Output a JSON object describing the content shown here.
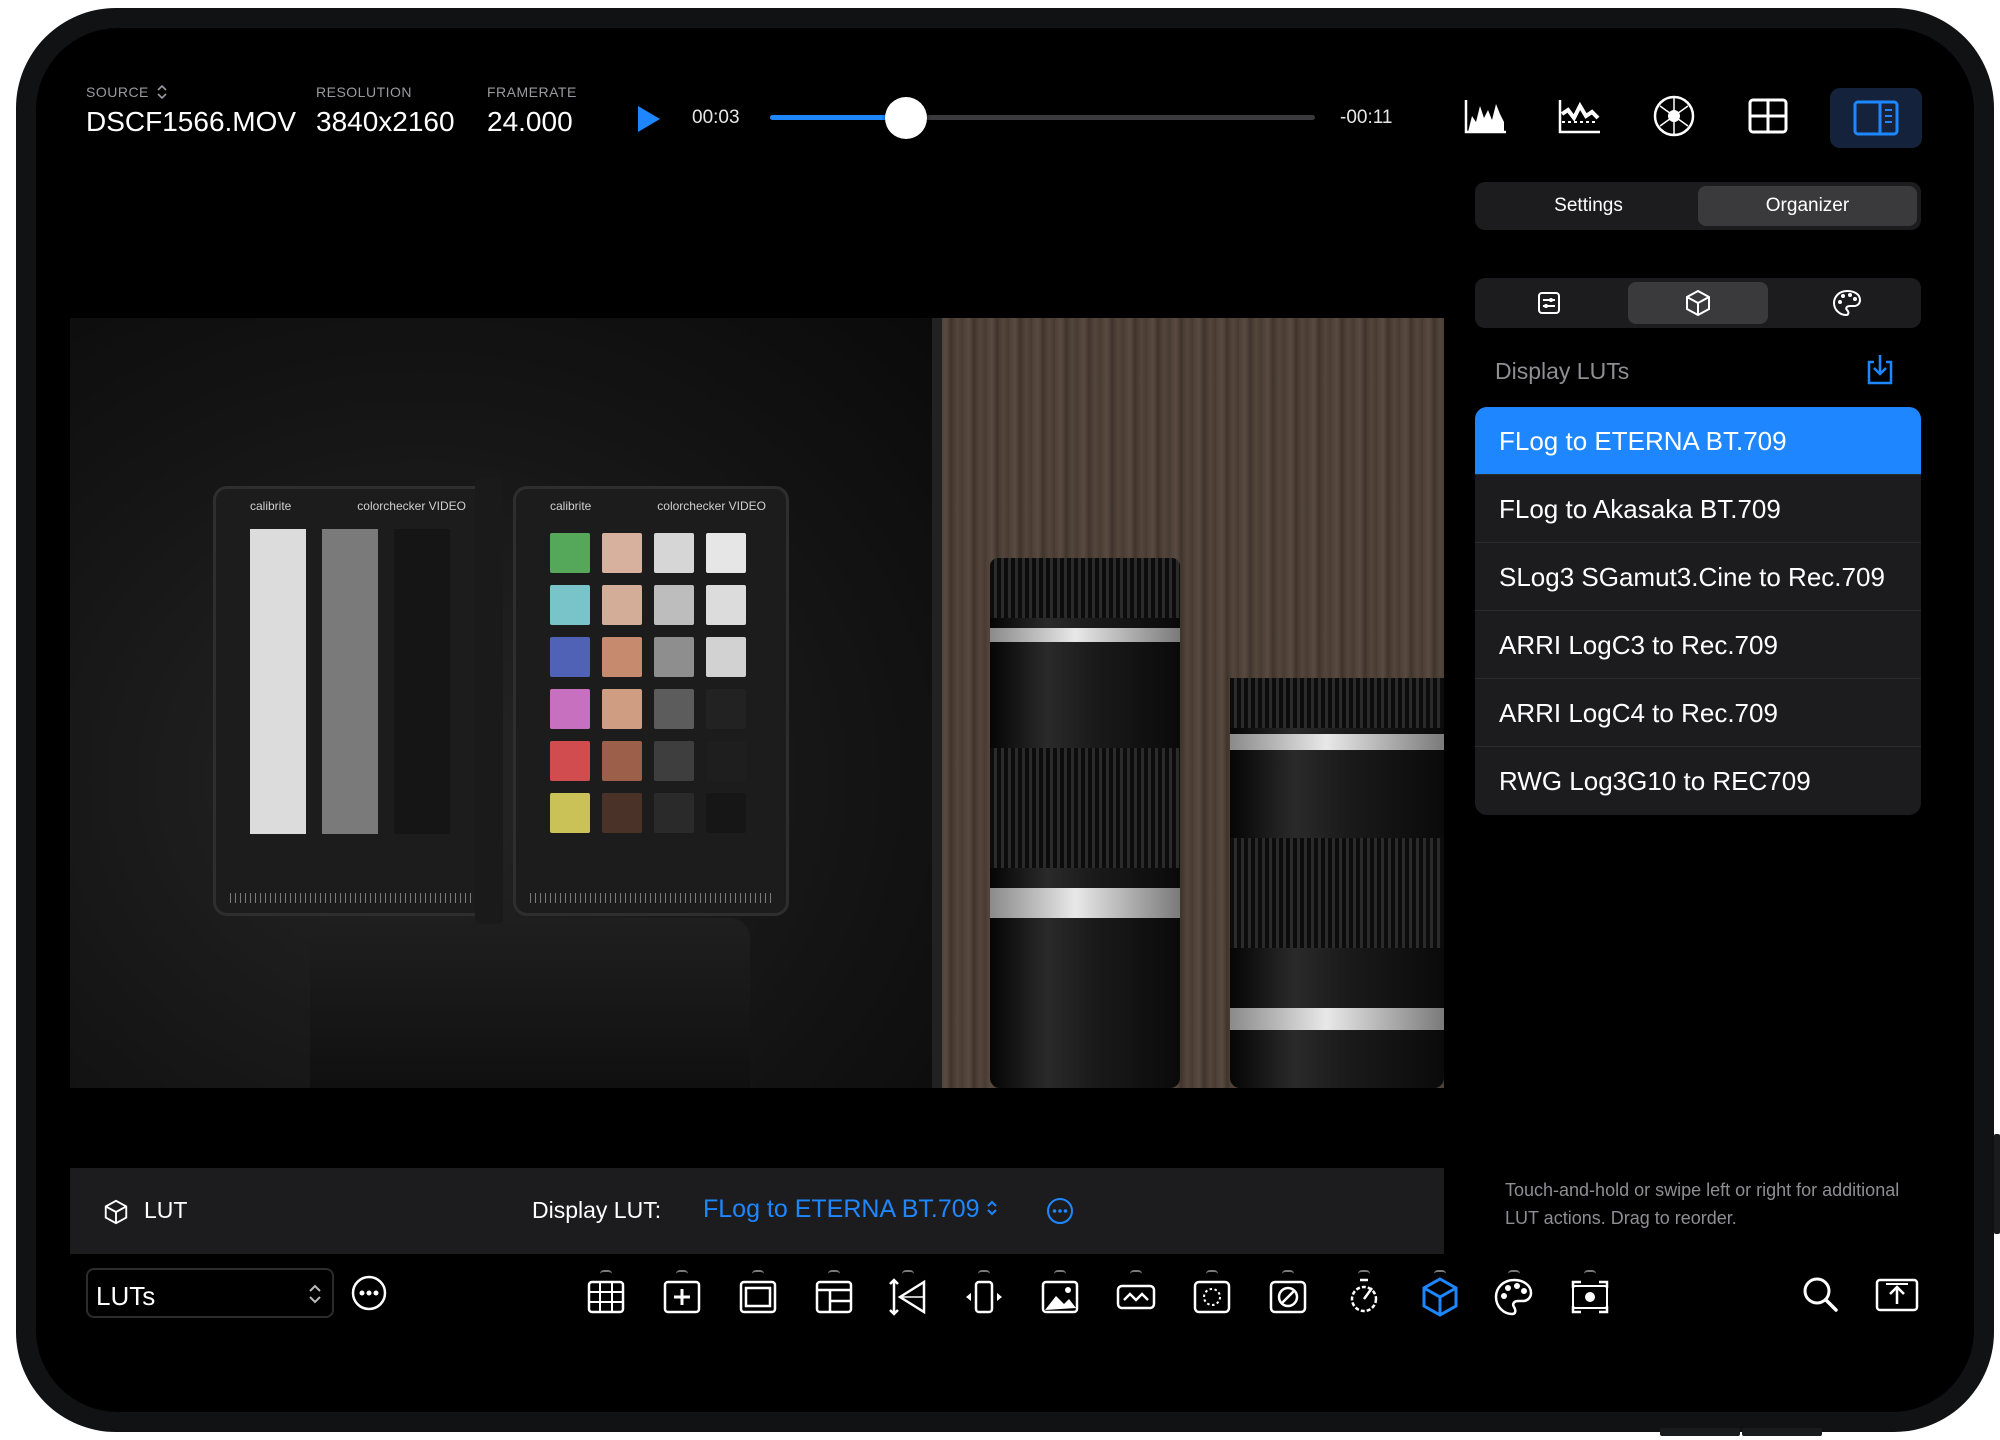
{
  "header": {
    "source": {
      "label": "SOURCE",
      "value": "DSCF1566.MOV"
    },
    "resolution": {
      "label": "RESOLUTION",
      "value": "3840x2160"
    },
    "framerate": {
      "label": "FRAMERATE",
      "value": "24.000"
    }
  },
  "playback": {
    "elapsed": "00:03",
    "remaining": "-00:11",
    "progress": 0.25
  },
  "colors": {
    "accent": "#1e87ff",
    "panel": "#1c1c1e",
    "background": "#000000"
  },
  "top_icons": [
    "histogram-icon",
    "waveform-icon",
    "vectorscope-icon",
    "grid-layout-icon",
    "side-panel-icon"
  ],
  "photo": {
    "left_brand": "calibrite",
    "left_title": "colorchecker VIDEO",
    "right_brand": "calibrite",
    "right_title": "colorchecker VIDEO"
  },
  "sidebar": {
    "tabs": [
      {
        "label": "Settings",
        "active": false
      },
      {
        "label": "Organizer",
        "active": true
      }
    ],
    "subtabs": [
      "sliders-icon",
      "cube-icon",
      "palette-icon"
    ],
    "section_title": "Display LUTs",
    "luts": [
      {
        "label": "FLog to ETERNA BT.709",
        "selected": true
      },
      {
        "label": "FLog to Akasaka BT.709",
        "selected": false
      },
      {
        "label": "SLog3 SGamut3.Cine to Rec.709",
        "selected": false
      },
      {
        "label": "ARRI LogC3 to Rec.709",
        "selected": false
      },
      {
        "label": "ARRI LogC4 to Rec.709",
        "selected": false
      },
      {
        "label": "RWG Log3G10 to REC709",
        "selected": false
      }
    ],
    "hint": "Touch-and-hold or swipe left or right for additional LUT actions. Drag to reorder."
  },
  "lutbar": {
    "title": "LUT",
    "display_label": "Display LUT:",
    "display_value": "FLog to ETERNA BT.709"
  },
  "toolbar": {
    "mode": "LUTs",
    "tools": [
      "grid-overlay-icon",
      "crosshair-icon",
      "frame-guide-icon",
      "safe-area-icon",
      "anamorphic-icon",
      "desqueeze-icon",
      "image-overlay-icon",
      "false-color-icon",
      "focus-peaking-icon",
      "zebra-icon",
      "exposure-icon",
      "lut-cube-icon",
      "color-palette-icon",
      "record-frame-icon"
    ],
    "active_tool": "lut-cube-icon",
    "right": [
      "search-icon",
      "export-icon"
    ]
  }
}
